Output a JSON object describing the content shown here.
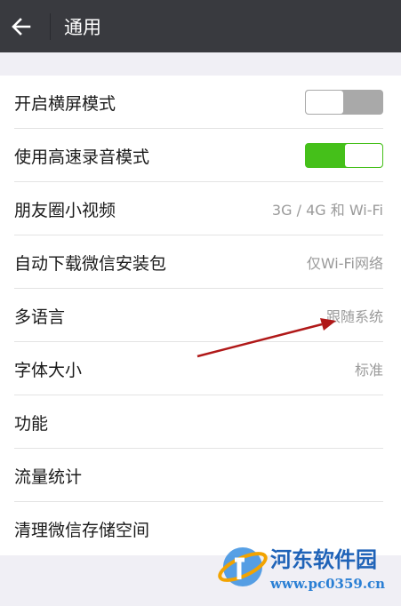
{
  "header": {
    "title": "通用",
    "back_icon": "back-arrow-icon"
  },
  "settings": [
    {
      "label": "开启横屏模式",
      "type": "switch",
      "on": false
    },
    {
      "label": "使用高速录音模式",
      "type": "switch",
      "on": true
    },
    {
      "label": "朋友圈小视频",
      "type": "value",
      "value": "3G / 4G 和 Wi-Fi"
    },
    {
      "label": "自动下载微信安装包",
      "type": "value",
      "value": "仅Wi-Fi网络"
    },
    {
      "label": "多语言",
      "type": "value",
      "value": "跟随系统"
    },
    {
      "label": "字体大小",
      "type": "value",
      "value": "标准"
    },
    {
      "label": "功能",
      "type": "none"
    },
    {
      "label": "流量统计",
      "type": "none"
    },
    {
      "label": "清理微信存储空间",
      "type": "none"
    }
  ],
  "watermark": {
    "name": "河东软件园",
    "url": "www.pc0359.cn"
  },
  "colors": {
    "header_bg": "#393a3f",
    "switch_on": "#45c01a",
    "switch_off": "#a9a9a9",
    "annotation_arrow": "#b01818"
  }
}
